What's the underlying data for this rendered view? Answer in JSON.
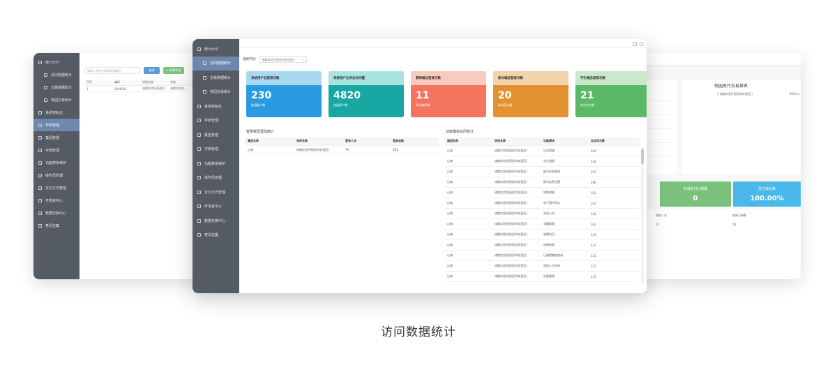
{
  "caption": "访问数据统计",
  "left_window": {
    "sidebar": [
      {
        "label": "统计大厅",
        "sub": false,
        "active": false
      },
      {
        "label": "访问数据统计",
        "sub": true,
        "active": false
      },
      {
        "label": "交易数据统计",
        "sub": true,
        "active": false
      },
      {
        "label": "校园交易统计",
        "sub": true,
        "active": false
      },
      {
        "label": "系统初始化",
        "sub": false,
        "active": false
      },
      {
        "label": "学校管理",
        "sub": false,
        "active": true
      },
      {
        "label": "集团管理",
        "sub": false,
        "active": false
      },
      {
        "label": "字典管理",
        "sub": false,
        "active": false
      },
      {
        "label": "功能菜单维护",
        "sub": false,
        "active": false
      },
      {
        "label": "操作员管理",
        "sub": false,
        "active": false
      },
      {
        "label": "支付方式管理",
        "sub": false,
        "active": false
      },
      {
        "label": "开发者中心",
        "sub": false,
        "active": false
      },
      {
        "label": "数据交换中心",
        "sub": false,
        "active": false
      },
      {
        "label": "意见征集",
        "sub": false,
        "active": false
      }
    ],
    "search_placeholder": "请输入学校名称或学校编码",
    "query_button": "查询",
    "add_button": "+ 新增学校",
    "table_headers": [
      "序号",
      "编码",
      "学校名称",
      "学校"
    ],
    "table_rows": [
      [
        "1",
        "1000001",
        "成都实验外国语学...",
        "成都实验外..."
      ]
    ]
  },
  "right_window": {
    "rank_title": "校园支付交易排名",
    "rank_item": "1  成都实验外国语学校(西区)",
    "rank_value": "5634.4",
    "cards": [
      {
        "title": "交易支付订单数",
        "value": "0",
        "color": "#7ac27c"
      },
      {
        "title": "支付成功率",
        "value": "100.00%",
        "color": "#4ab8e8"
      }
    ],
    "headers": [
      "销售人次",
      "销售订单数"
    ],
    "values": [
      "12",
      "78"
    ]
  },
  "center_window": {
    "sidebar": [
      {
        "label": "统计大厅",
        "sub": false,
        "active": false
      },
      {
        "label": "访问数据统计",
        "sub": true,
        "active": true
      },
      {
        "label": "交易数据统计",
        "sub": true,
        "active": false
      },
      {
        "label": "校园交易统计",
        "sub": true,
        "active": false
      },
      {
        "label": "系统初始化",
        "sub": false,
        "active": false
      },
      {
        "label": "学校管理",
        "sub": false,
        "active": false
      },
      {
        "label": "集团管理",
        "sub": false,
        "active": false
      },
      {
        "label": "字典管理",
        "sub": false,
        "active": false
      },
      {
        "label": "功能菜单维护",
        "sub": false,
        "active": false
      },
      {
        "label": "操作员管理",
        "sub": false,
        "active": false
      },
      {
        "label": "支付方式管理",
        "sub": false,
        "active": false
      },
      {
        "label": "开发者中心",
        "sub": false,
        "active": false
      },
      {
        "label": "数据交换中心",
        "sub": false,
        "active": false
      },
      {
        "label": "意见征集",
        "sub": false,
        "active": false
      }
    ],
    "school_label": "选择学校:",
    "school_value": "成都实验外国语学校(西区)",
    "stat_cards": [
      {
        "title": "系统用户总登录次数",
        "value": "230",
        "label": "校园客户端",
        "head": "#a9d8f2",
        "body": "#2a9be0"
      },
      {
        "title": "系统用户业务总访问量",
        "value": "4820",
        "label": "校园客户端",
        "head": "#a8e3e0",
        "body": "#17a8a3"
      },
      {
        "title": "教师端总登录次数",
        "value": "11",
        "label": "移动教师端",
        "head": "#fbcabe",
        "body": "#f5745d"
      },
      {
        "title": "家长端总登录次数",
        "value": "20",
        "label": "移动家长端",
        "head": "#f3d3aa",
        "body": "#e29230"
      },
      {
        "title": "学生端总登录次数",
        "value": "21",
        "label": "移动学生端",
        "head": "#c9e8cc",
        "body": "#5bb866"
      }
    ],
    "left_table": {
      "title": "智慧校园登陆统计",
      "headers": [
        "集团名称",
        "学校名称",
        "登录人次",
        "登录总数"
      ],
      "rows": [
        [
          "山海",
          "成都实验外国语学校(西区)",
          "79",
          "301"
        ]
      ]
    },
    "right_table": {
      "title": "功能模块访问统计",
      "headers": [
        "集团名称",
        "学校名称",
        "功能模块",
        "总访问次数"
      ],
      "rows": [
        [
          "山海",
          "成都实验外国语学校(西区)",
          "后台管理",
          "240"
        ],
        [
          "山海",
          "成都实验外国语学校(西区)",
          "学生请假",
          "234"
        ],
        [
          "山海",
          "成都实验外国语学校(西区)",
          "报名信息查询",
          "201"
        ],
        [
          "山海",
          "成都实验外国语学校(西区)",
          "报名信息设置",
          "196"
        ],
        [
          "山海",
          "成都实验外国语学校(西区)",
          "销售明细",
          "163"
        ],
        [
          "山海",
          "成都实验外国语学校(西区)",
          "电子围栏地点",
          "162"
        ],
        [
          "山海",
          "成都实验外国语学校(西区)",
          "消息公告",
          "162"
        ],
        [
          "山海",
          "成都实验外国语学校(西区)",
          "学籍管理",
          "162"
        ],
        [
          "山海",
          "成都实验外国语学校(西区)",
          "收费项目",
          "143"
        ],
        [
          "山海",
          "成都实验外国语学校(西区)",
          "成绩查询",
          "131"
        ],
        [
          "山海",
          "成都实验外国语学校(西区)",
          "已缴费数据查询",
          "131"
        ],
        [
          "山海",
          "成都实验外国语学校(西区)",
          "资助人员名单",
          "115"
        ],
        [
          "山海",
          "成都实验外国语学校(西区)",
          "设备管理",
          "115"
        ]
      ]
    }
  }
}
